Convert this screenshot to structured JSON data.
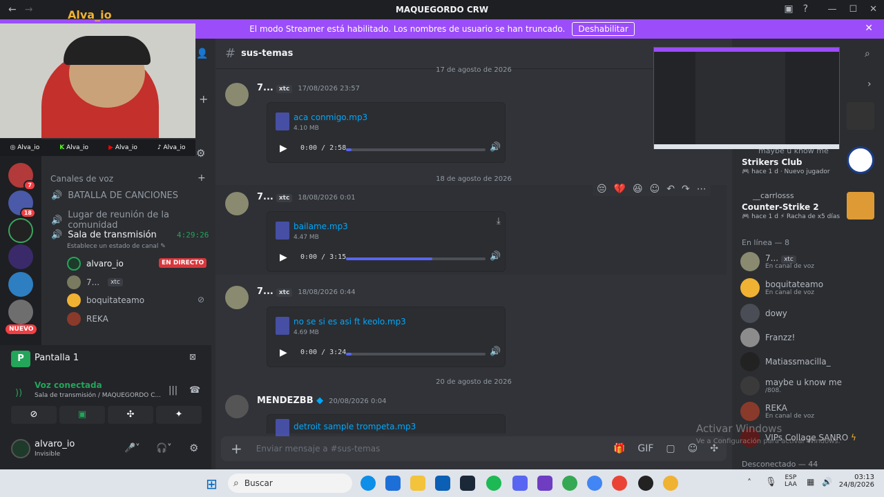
{
  "window": {
    "title": "MAQUEGORDO CRW"
  },
  "banner": {
    "text": "El modo Streamer está habilitado. Los nombres de usuario se han truncado.",
    "button": "Deshabilitar"
  },
  "webcam": {
    "name": "Alva_io",
    "socials": [
      "Alva_io",
      "Alva_io",
      "Alva_io",
      "Alva_io"
    ]
  },
  "servers": {
    "badges": [
      "7",
      "18"
    ],
    "new_label": "NUEVO"
  },
  "sidebar": {
    "voice_header": "Canales de voz",
    "channels": [
      {
        "name": "BATALLA DE CANCIONES"
      },
      {
        "name": "Lugar de reunión de la comunidad"
      },
      {
        "name": "Sala de transmisión",
        "timer": "4:29:26",
        "status": "Establece un estado de canal"
      }
    ],
    "members": [
      {
        "name": "alvaro_io",
        "live": "EN DIRECTO"
      },
      {
        "name": "7...",
        "tag": "xtc"
      },
      {
        "name": "boquitateamo"
      },
      {
        "name": "REKA"
      }
    ]
  },
  "voice": {
    "screen": "Pantalla 1",
    "status": "Voz conectada",
    "detail": "Sala de transmisión / MAQUEGORDO C..."
  },
  "user": {
    "name": "alvaro_io",
    "status": "Invisible"
  },
  "chat": {
    "channel": "sus-temas",
    "dates": [
      "17 de agosto de 2026",
      "18 de agosto de 2026",
      "20 de agosto de 2026"
    ],
    "messages": [
      {
        "user": "7...",
        "tag": "xtc",
        "time": "17/08/2026 23:57",
        "file": "aca conmigo.mp3",
        "size": "4.10 MB",
        "time_display": "0:00 / 2:58",
        "progress": 0
      },
      {
        "user": "7...",
        "tag": "xtc",
        "time": "18/08/2026 0:01",
        "file": "bailame.mp3",
        "size": "4.47 MB",
        "time_display": "0:00 / 3:15",
        "progress": 0.62
      },
      {
        "user": "7...",
        "tag": "xtc",
        "time": "18/08/2026 0:44",
        "file": "no se si es asi ft keolo.mp3",
        "size": "4.69 MB",
        "time_display": "0:00 / 3:24",
        "progress": 0
      },
      {
        "user": "MENDEZBB",
        "time": "20/08/2026 0:04",
        "file": "detroit sample trompeta.mp3"
      }
    ],
    "placeholder": "Enviar mensaje a #sus-temas"
  },
  "members": {
    "activities": [
      {
        "name": "Strikers Club",
        "meta": "hace 1 d",
        "extra": "Nuevo jugador"
      },
      {
        "user": "__carrlosss",
        "name": "Counter-Strike 2",
        "meta": "hace 1 d",
        "extra": "Racha de x5 días"
      }
    ],
    "online_header": "En línea — 8",
    "online": [
      {
        "name": "7...",
        "tag": "xtc",
        "sub": "En canal de voz"
      },
      {
        "name": "boquitateamo",
        "sub": "En canal de voz"
      },
      {
        "name": "dowy"
      },
      {
        "name": "Franzz!"
      },
      {
        "name": "Matiassmacilla_"
      },
      {
        "name": "maybe u know me",
        "sub": "/808."
      },
      {
        "name": "REKA",
        "sub": "En canal de voz"
      },
      {
        "name": "VIPs Collage SANRO"
      }
    ],
    "offline_header": "Desconectado — 44",
    "peek": "maybe u know me"
  },
  "watermark": {
    "line1": "Activar Windows",
    "line2": "Ve a Configuración para activar Windows."
  },
  "taskbar": {
    "search": "Buscar",
    "lang1": "ESP",
    "lang2": "LAA",
    "clock": "03:13",
    "date": "24/8/2026"
  }
}
